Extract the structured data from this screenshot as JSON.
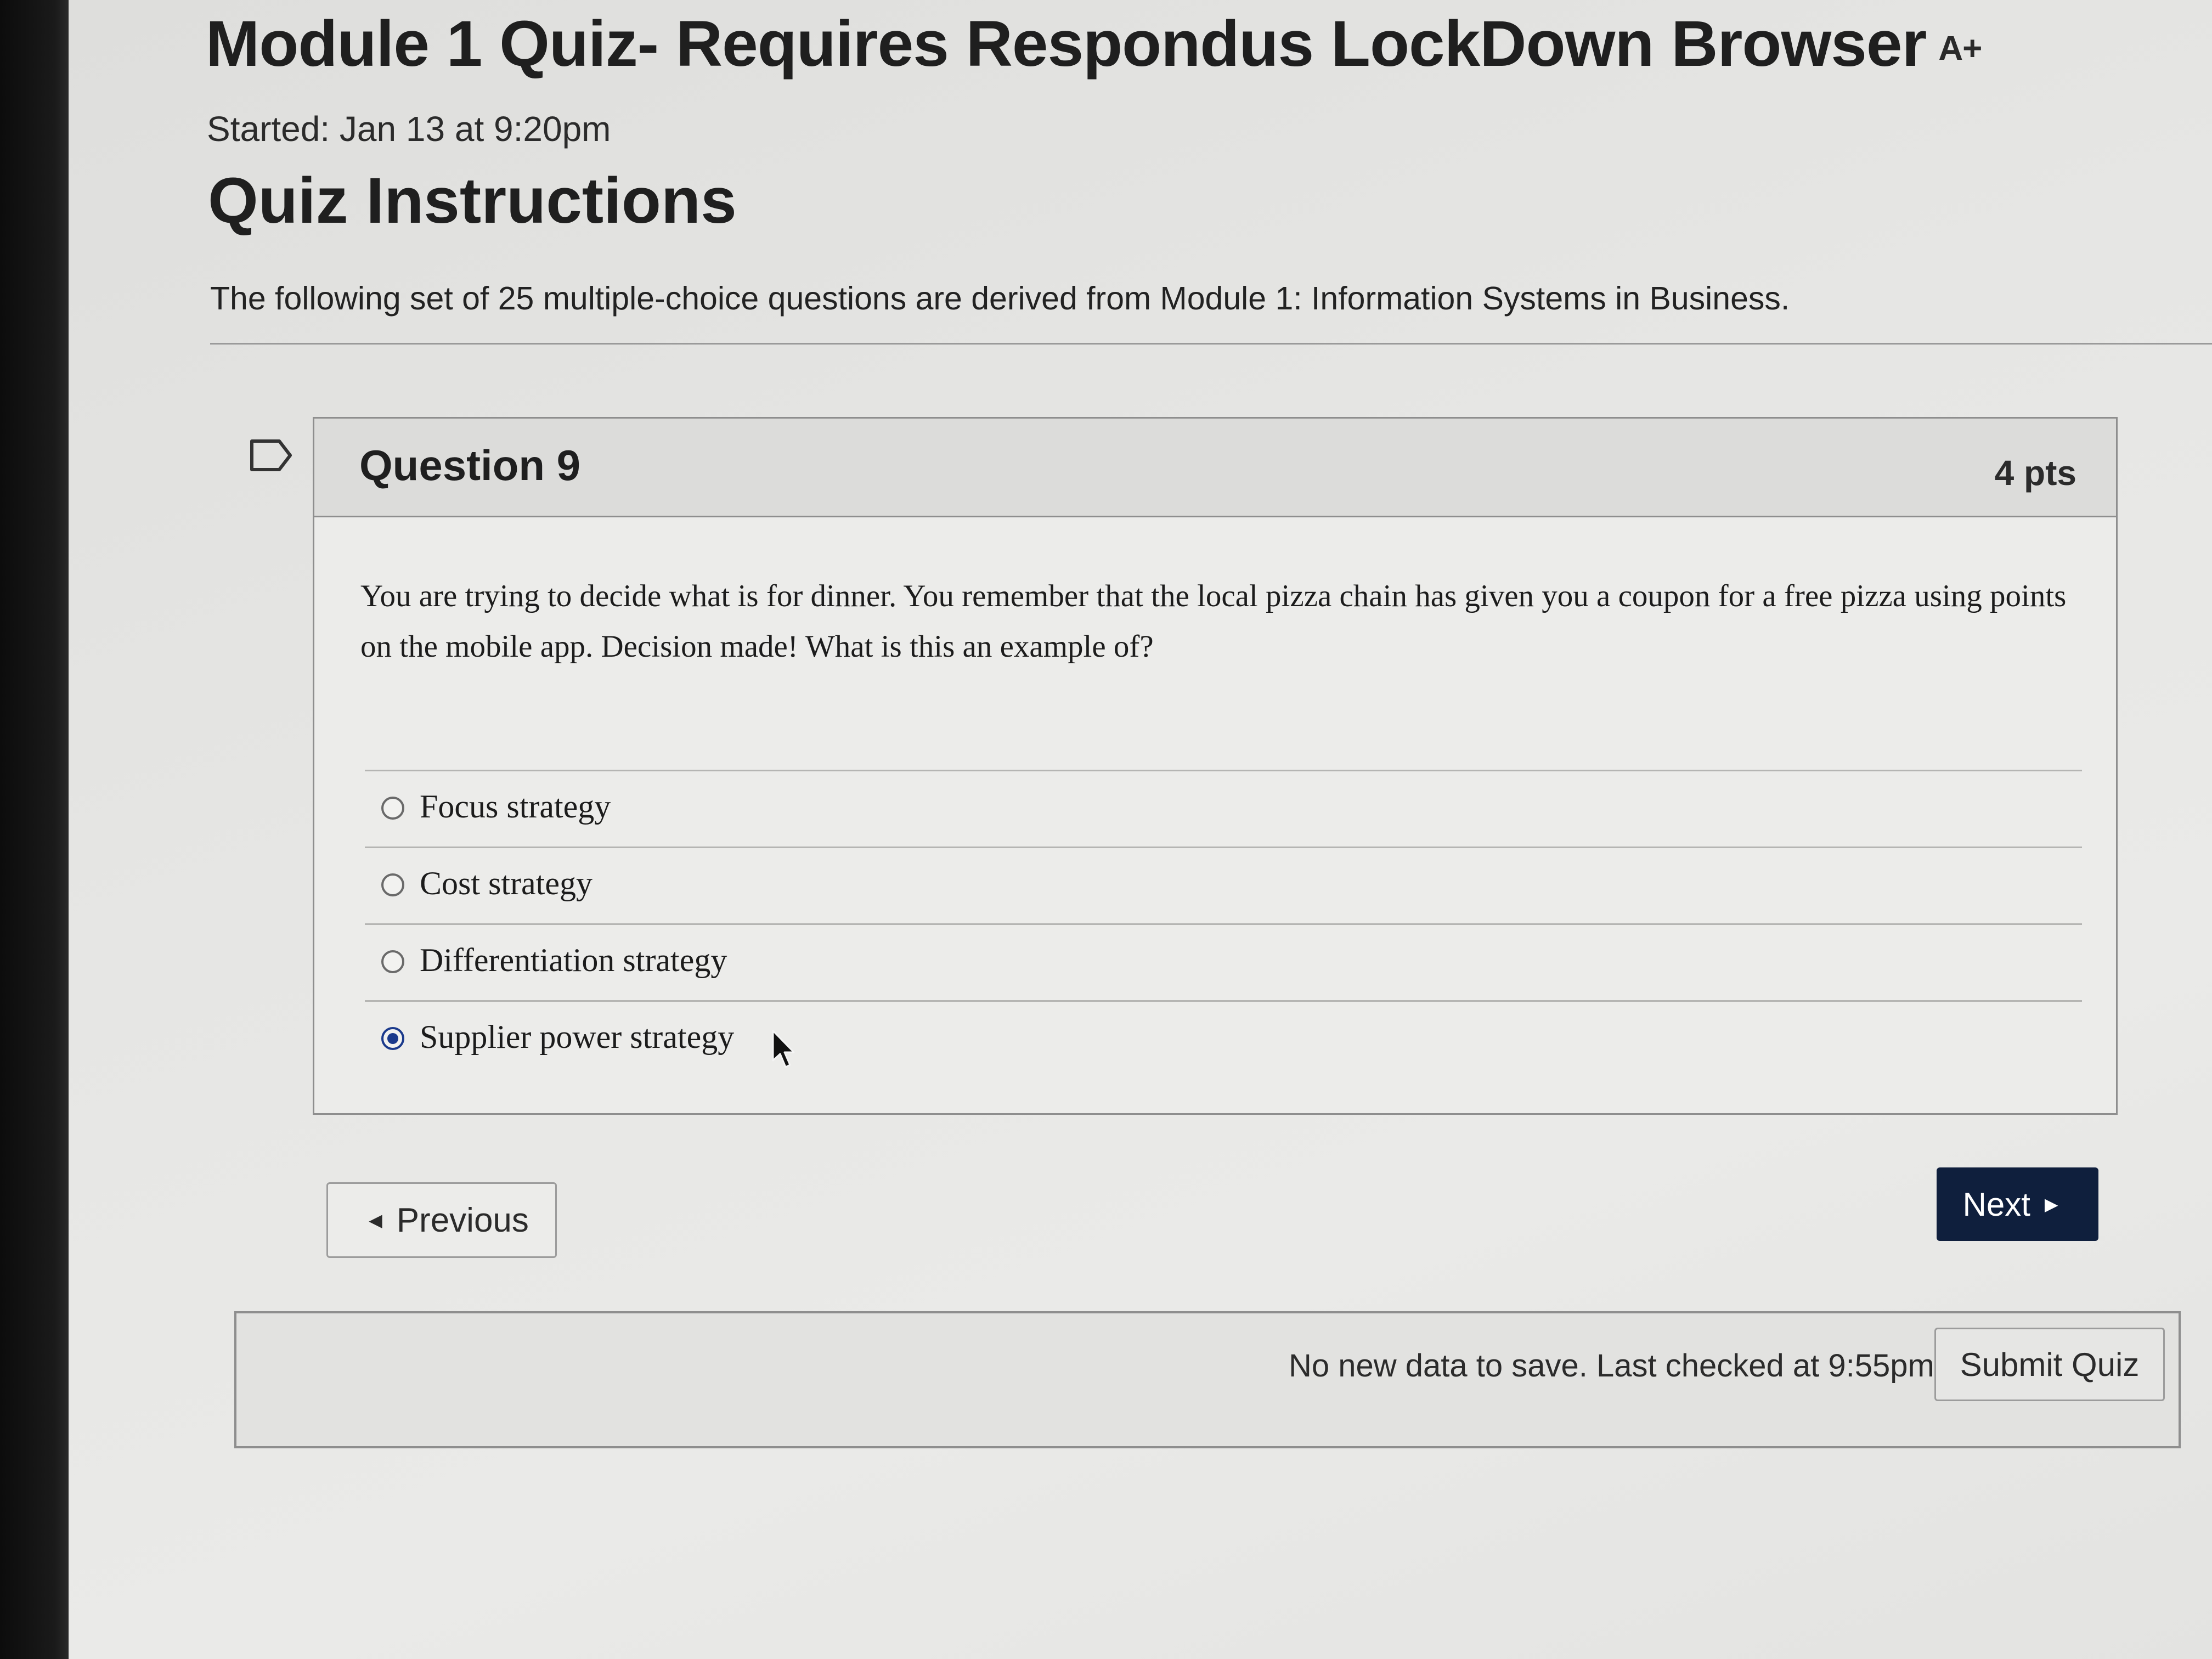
{
  "page": {
    "title": "Module 1 Quiz- Requires Respondus LockDown Browser",
    "title_icon": "A+",
    "title_icon_name": "text-size-icon",
    "started": "Started: Jan 13 at 9:20pm"
  },
  "instructions": {
    "heading": "Quiz Instructions",
    "text": "The following set of 25 multiple-choice questions are derived from Module 1: Information Systems in Business."
  },
  "question": {
    "number_label": "Question 9",
    "points": "4 pts",
    "text": "You are trying to decide what is for dinner. You remember that the local pizza chain has given you a coupon for a free pizza using points on the mobile app. Decision made! What is this an example of?",
    "answers": [
      {
        "label": "Focus strategy",
        "selected": false
      },
      {
        "label": "Cost strategy",
        "selected": false
      },
      {
        "label": "Differentiation strategy",
        "selected": false
      },
      {
        "label": "Supplier power strategy",
        "selected": true
      }
    ]
  },
  "navigation": {
    "previous_label": "Previous",
    "next_label": "Next"
  },
  "status": {
    "save_text": "No new data to save. Last checked at 9:55pm",
    "submit_label": "Submit Quiz"
  },
  "colors": {
    "selected_radio": "#1b3a8c",
    "next_button_bg": "#0f1f3d",
    "background": "#e6e6e4"
  }
}
